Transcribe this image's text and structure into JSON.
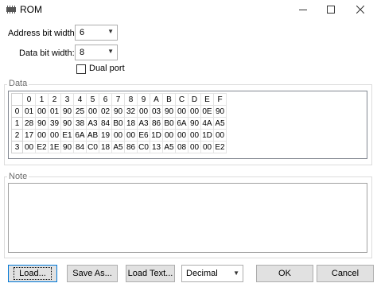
{
  "window": {
    "title": "ROM",
    "icon": "chip-icon"
  },
  "fields": {
    "address_label": "Address bit width:",
    "address_value": "6",
    "data_label": "Data bit width:",
    "data_value": "8",
    "dual_port_label": "Dual port",
    "dual_port_checked": false
  },
  "data_group": {
    "caption": "Data",
    "columns": [
      "0",
      "1",
      "2",
      "3",
      "4",
      "5",
      "6",
      "7",
      "8",
      "9",
      "A",
      "B",
      "C",
      "D",
      "E",
      "F"
    ],
    "rows": [
      {
        "label": "0",
        "cells": [
          "01",
          "00",
          "01",
          "90",
          "25",
          "00",
          "02",
          "90",
          "32",
          "00",
          "03",
          "90",
          "00",
          "00",
          "0E",
          "90"
        ]
      },
      {
        "label": "1",
        "cells": [
          "28",
          "90",
          "39",
          "90",
          "38",
          "A3",
          "84",
          "B0",
          "18",
          "A3",
          "86",
          "B0",
          "6A",
          "90",
          "4A",
          "A5"
        ]
      },
      {
        "label": "2",
        "cells": [
          "17",
          "00",
          "00",
          "E1",
          "6A",
          "AB",
          "19",
          "00",
          "00",
          "E6",
          "1D",
          "00",
          "00",
          "00",
          "1D",
          "00"
        ]
      },
      {
        "label": "3",
        "cells": [
          "00",
          "E2",
          "1E",
          "90",
          "84",
          "C0",
          "18",
          "A5",
          "86",
          "C0",
          "13",
          "A5",
          "08",
          "00",
          "00",
          "E2"
        ]
      }
    ]
  },
  "note_group": {
    "caption": "Note",
    "value": ""
  },
  "buttons": {
    "load": "Load...",
    "save_as": "Save As...",
    "load_text": "Load Text...",
    "format_value": "Decimal",
    "ok": "OK",
    "cancel": "Cancel"
  }
}
